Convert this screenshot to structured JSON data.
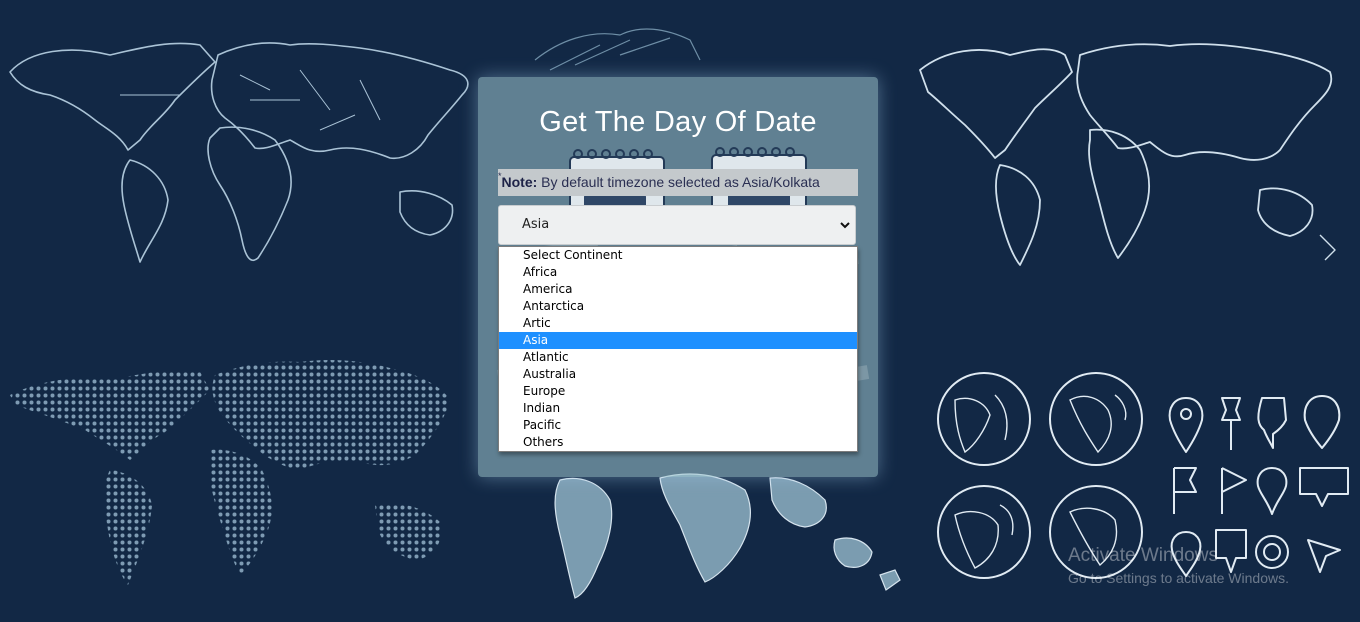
{
  "title": "Get The Day Of Date",
  "note": {
    "asterisk": "*",
    "label": "Note:",
    "text": " By default timezone selected as Asia/Kolkata"
  },
  "continent_select": {
    "selected": "Asia",
    "options": [
      "Select Continent",
      "Africa",
      "America",
      "Antarctica",
      "Artic",
      "Asia",
      "Atlantic",
      "Australia",
      "Europe",
      "Indian",
      "Pacific",
      "Others"
    ],
    "highlighted_index": 5
  },
  "watermark": {
    "line1": "Activate Windows",
    "line2": "Go to Settings to activate Windows."
  },
  "icons": {
    "select_arrow": "chevron-down-icon",
    "decor": [
      "world-map-outline",
      "world-map-dotted",
      "globe-icon",
      "map-pin-icon",
      "flag-icon",
      "push-pin-icon",
      "navigation-arrow-icon",
      "calendar-icon"
    ]
  },
  "colors": {
    "background": "#122845",
    "highlight": "#1e90ff",
    "map_stroke": "#c9dbe8",
    "dot": "#7e9bb3"
  }
}
